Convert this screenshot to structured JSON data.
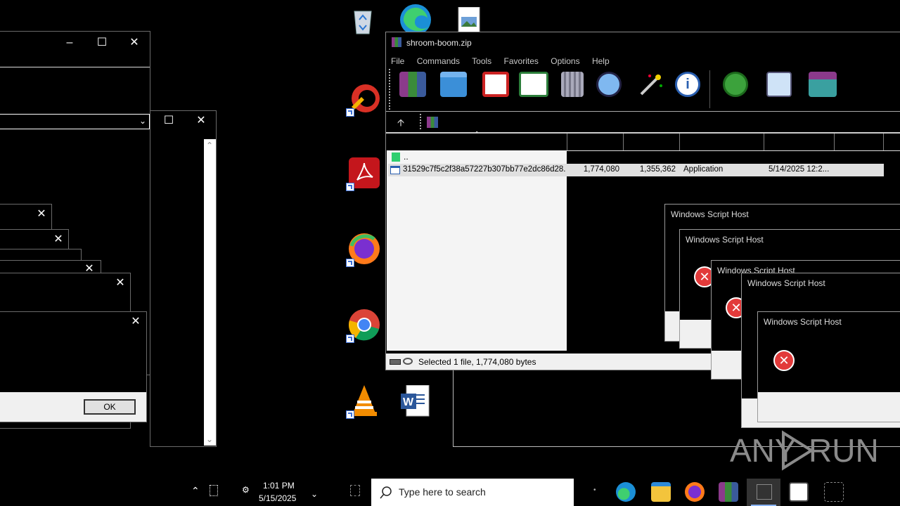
{
  "winrar": {
    "title": "shroom-boom.zip",
    "menu": [
      "File",
      "Commands",
      "Tools",
      "Favorites",
      "Options",
      "Help"
    ],
    "file_row": {
      "parent": "..",
      "name": "31529c7f5c2f38a57227b307bb77e2dc86d28...",
      "size": "1,774,080",
      "packed": "1,355,362",
      "type": "Application",
      "modified": "5/14/2025 12:2..."
    },
    "status": "Selected 1 file, 1,774,080 bytes"
  },
  "dialogs": {
    "ok_label": "OK",
    "wsh_titles": [
      "Windows Script Host",
      "Windows Script Host",
      "Windows Script Host",
      "Windows Script Host",
      "Windows Script Host"
    ]
  },
  "taskbar": {
    "search_placeholder": "Type here to search",
    "time": "1:01 PM",
    "date": "5/15/2025"
  },
  "watermark": {
    "left": "ANY",
    "right": "RUN"
  },
  "colors": {
    "selection": "#e0e0e0",
    "error": "#e23a3a",
    "taskbar_search_bg": "#ffffff"
  }
}
